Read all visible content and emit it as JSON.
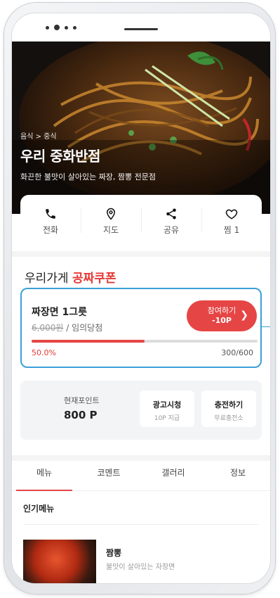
{
  "store": {
    "breadcrumb": "음식 > 중식",
    "name": "우리 중화반점",
    "description": "화끈한 불맛이 살아있는 짜장, 짬뽕 전문점"
  },
  "actions": [
    {
      "label": "전화",
      "icon": "phone-icon"
    },
    {
      "label": "지도",
      "icon": "map-pin-icon"
    },
    {
      "label": "공유",
      "icon": "share-icon"
    },
    {
      "label": "찜 1",
      "icon": "heart-icon"
    }
  ],
  "coupon": {
    "title_prefix": "우리가게 ",
    "title_highlight": "공짜쿠폰",
    "item": "짜장면 1그릇",
    "original_price": "6,000원",
    "draw_note": " / 임의당첨",
    "join_label": "참여하기",
    "join_cost": "-10P",
    "progress_percent": 50.0,
    "progress_text": "50.0%",
    "count_text": "300/600"
  },
  "points": {
    "label": "현재포인트",
    "value": "800 P",
    "ad_button": {
      "title": "광고시청",
      "sub": "10P 지급"
    },
    "charge_button": {
      "title": "충전하기",
      "sub": "무료충전소"
    }
  },
  "tabs": [
    "메뉴",
    "코멘트",
    "갤러리",
    "정보"
  ],
  "menu": {
    "section_title": "인기메뉴",
    "items": [
      {
        "name": "짬뽕",
        "description": "불맛이 살아있는 자장면"
      }
    ]
  },
  "colors": {
    "accent": "#e64545",
    "highlight_border": "#3aa0d8"
  }
}
